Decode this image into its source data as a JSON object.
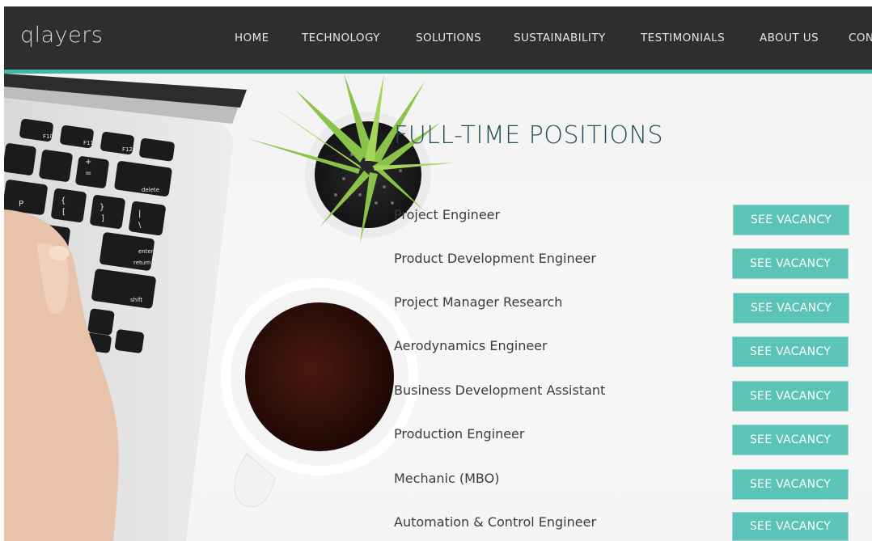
{
  "brand": {
    "logo_text": "qlayers"
  },
  "nav": {
    "items": [
      {
        "label": "HOME"
      },
      {
        "label": "TECHNOLOGY"
      },
      {
        "label": "SOLUTIONS"
      },
      {
        "label": "SUSTAINABILITY"
      },
      {
        "label": "TESTIMONIALS"
      },
      {
        "label": "ABOUT US"
      },
      {
        "label": "CON"
      }
    ]
  },
  "content": {
    "section_title": "FULL-TIME POSITIONS",
    "button_label": "SEE VACANCY",
    "jobs": [
      {
        "title": "Project Engineer"
      },
      {
        "title": "Product Development Engineer"
      },
      {
        "title": "Project Manager Research"
      },
      {
        "title": "Aerodynamics Engineer"
      },
      {
        "title": "Business Development Assistant"
      },
      {
        "title": "Production Engineer"
      },
      {
        "title": "Mechanic (MBO)"
      },
      {
        "title": "Automation & Control Engineer"
      }
    ]
  },
  "keyboard": {
    "keys": [
      "F10",
      "F11",
      "F12",
      "delete",
      "P",
      "{",
      "[",
      "}",
      "]",
      "|",
      "\\",
      "enter",
      "return",
      "shift",
      "+",
      "="
    ]
  },
  "colors": {
    "nav_bg": "#2e2e2e",
    "accent": "#43b6a8",
    "button_bg": "#5cc4b7",
    "title": "#1f4f58"
  }
}
